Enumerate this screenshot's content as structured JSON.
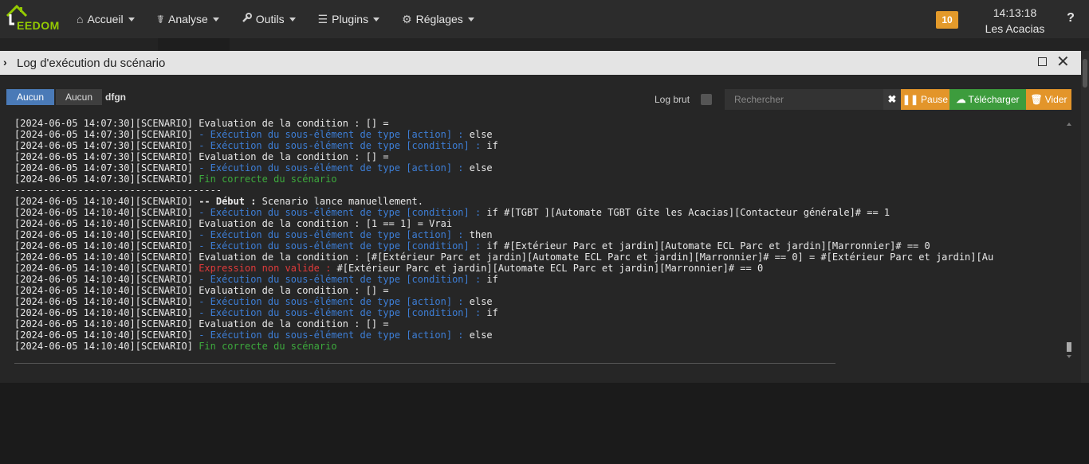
{
  "navbar": {
    "logo_text": "EEDOM",
    "menu": [
      {
        "label": "Accueil",
        "icon": "home-icon",
        "glyph": "⌂"
      },
      {
        "label": "Analyse",
        "icon": "stethoscope-icon",
        "glyph": "☤"
      },
      {
        "label": "Outils",
        "icon": "wrench-icon",
        "glyph": "🔧"
      },
      {
        "label": "Plugins",
        "icon": "tasks-icon",
        "glyph": "☰"
      },
      {
        "label": "Réglages",
        "icon": "gear-icon",
        "glyph": "⚙"
      }
    ],
    "badge": "10",
    "time": "14:13:18",
    "location": "Les Acacias",
    "help": "?"
  },
  "modal": {
    "title": "Log d'exécution du scénario",
    "toolbar": {
      "aucun_primary": "Aucun",
      "aucun_secondary": "Aucun",
      "tag": "dfgn",
      "log_brut_label": "Log brut",
      "search_placeholder": "Rechercher",
      "pause_label": "Pause",
      "download_label": "Télécharger",
      "clear_label": "Vider"
    },
    "log_lines": [
      [
        {
          "t": "[2024-06-05 14:07:30][SCENARIO] Evaluation de la condition : [] ="
        }
      ],
      [
        {
          "t": "[2024-06-05 14:07:30][SCENARIO] "
        },
        {
          "t": "- Exécution du sous-élément de type [action] :",
          "c": "blue"
        },
        {
          "t": " else"
        }
      ],
      [
        {
          "t": "[2024-06-05 14:07:30][SCENARIO] "
        },
        {
          "t": "- Exécution du sous-élément de type [condition] :",
          "c": "blue"
        },
        {
          "t": " if"
        }
      ],
      [
        {
          "t": "[2024-06-05 14:07:30][SCENARIO] Evaluation de la condition : [] ="
        }
      ],
      [
        {
          "t": "[2024-06-05 14:07:30][SCENARIO] "
        },
        {
          "t": "- Exécution du sous-élément de type [action] :",
          "c": "blue"
        },
        {
          "t": " else"
        }
      ],
      [
        {
          "t": "[2024-06-05 14:07:30][SCENARIO] "
        },
        {
          "t": "Fin correcte du scénario",
          "c": "green"
        }
      ],
      [
        {
          "t": "------------------------------------"
        }
      ],
      [
        {
          "t": "[2024-06-05 14:10:40][SCENARIO] "
        },
        {
          "t": "-- Début :",
          "c": "bold"
        },
        {
          "t": " Scenario lance manuellement."
        }
      ],
      [
        {
          "t": "[2024-06-05 14:10:40][SCENARIO] "
        },
        {
          "t": "- Exécution du sous-élément de type [condition] :",
          "c": "blue"
        },
        {
          "t": " if #[TGBT ][Automate TGBT Gîte les Acacias][Contacteur générale]# == 1"
        }
      ],
      [
        {
          "t": "[2024-06-05 14:10:40][SCENARIO] Evaluation de la condition : [1 == 1] = Vrai"
        }
      ],
      [
        {
          "t": "[2024-06-05 14:10:40][SCENARIO] "
        },
        {
          "t": "- Exécution du sous-élément de type [action] :",
          "c": "blue"
        },
        {
          "t": " then"
        }
      ],
      [
        {
          "t": "[2024-06-05 14:10:40][SCENARIO] "
        },
        {
          "t": "- Exécution du sous-élément de type [condition] :",
          "c": "blue"
        },
        {
          "t": " if #[Extérieur Parc et jardin][Automate ECL Parc et jardin][Marronnier]# == 0"
        }
      ],
      [
        {
          "t": "[2024-06-05 14:10:40][SCENARIO] Evaluation de la condition : [#[Extérieur Parc et jardin][Automate ECL Parc et jardin][Marronnier]# == 0] = #[Extérieur Parc et jardin][Au"
        }
      ],
      [
        {
          "t": "[2024-06-05 14:10:40][SCENARIO] "
        },
        {
          "t": "Expression non valide :",
          "c": "red"
        },
        {
          "t": " #[Extérieur Parc et jardin][Automate ECL Parc et jardin][Marronnier]# == 0"
        }
      ],
      [
        {
          "t": "[2024-06-05 14:10:40][SCENARIO] "
        },
        {
          "t": "- Exécution du sous-élément de type [condition] :",
          "c": "blue"
        },
        {
          "t": " if"
        }
      ],
      [
        {
          "t": "[2024-06-05 14:10:40][SCENARIO] Evaluation de la condition : [] ="
        }
      ],
      [
        {
          "t": "[2024-06-05 14:10:40][SCENARIO] "
        },
        {
          "t": "- Exécution du sous-élément de type [action] :",
          "c": "blue"
        },
        {
          "t": " else"
        }
      ],
      [
        {
          "t": "[2024-06-05 14:10:40][SCENARIO] "
        },
        {
          "t": "- Exécution du sous-élément de type [condition] :",
          "c": "blue"
        },
        {
          "t": " if"
        }
      ],
      [
        {
          "t": "[2024-06-05 14:10:40][SCENARIO] Evaluation de la condition : [] ="
        }
      ],
      [
        {
          "t": "[2024-06-05 14:10:40][SCENARIO] "
        },
        {
          "t": "- Exécution du sous-élément de type [action] :",
          "c": "blue"
        },
        {
          "t": " else"
        }
      ],
      [
        {
          "t": "[2024-06-05 14:10:40][SCENARIO] "
        },
        {
          "t": "Fin correcte du scénario",
          "c": "green"
        }
      ]
    ]
  }
}
